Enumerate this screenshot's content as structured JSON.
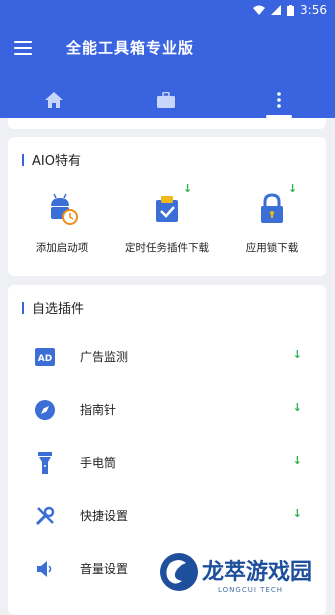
{
  "status": {
    "time": "3:56"
  },
  "app": {
    "title": "全能工具箱专业版"
  },
  "tabs": [
    {
      "icon": "home-icon"
    },
    {
      "icon": "briefcase-icon"
    },
    {
      "icon": "more-vertical-icon"
    }
  ],
  "aio": {
    "title": "AIO特有",
    "items": [
      {
        "label": "添加启动项",
        "icon": "android-timer-icon"
      },
      {
        "label": "定时任务插件下载",
        "icon": "calendar-check-icon"
      },
      {
        "label": "应用锁下载",
        "icon": "lock-icon"
      }
    ]
  },
  "plugins": {
    "title": "自选插件",
    "items": [
      {
        "label": "广告监测",
        "icon": "ad-icon"
      },
      {
        "label": "指南针",
        "icon": "compass-icon"
      },
      {
        "label": "手电筒",
        "icon": "flashlight-icon"
      },
      {
        "label": "快捷设置",
        "icon": "tools-icon"
      },
      {
        "label": "音量设置",
        "icon": "speaker-icon"
      }
    ]
  },
  "watermark": {
    "text": "龙萃游戏园",
    "sub": "LONGCUI TECH"
  },
  "colors": {
    "primary": "#3a63e0",
    "download": "#2bb24c"
  }
}
